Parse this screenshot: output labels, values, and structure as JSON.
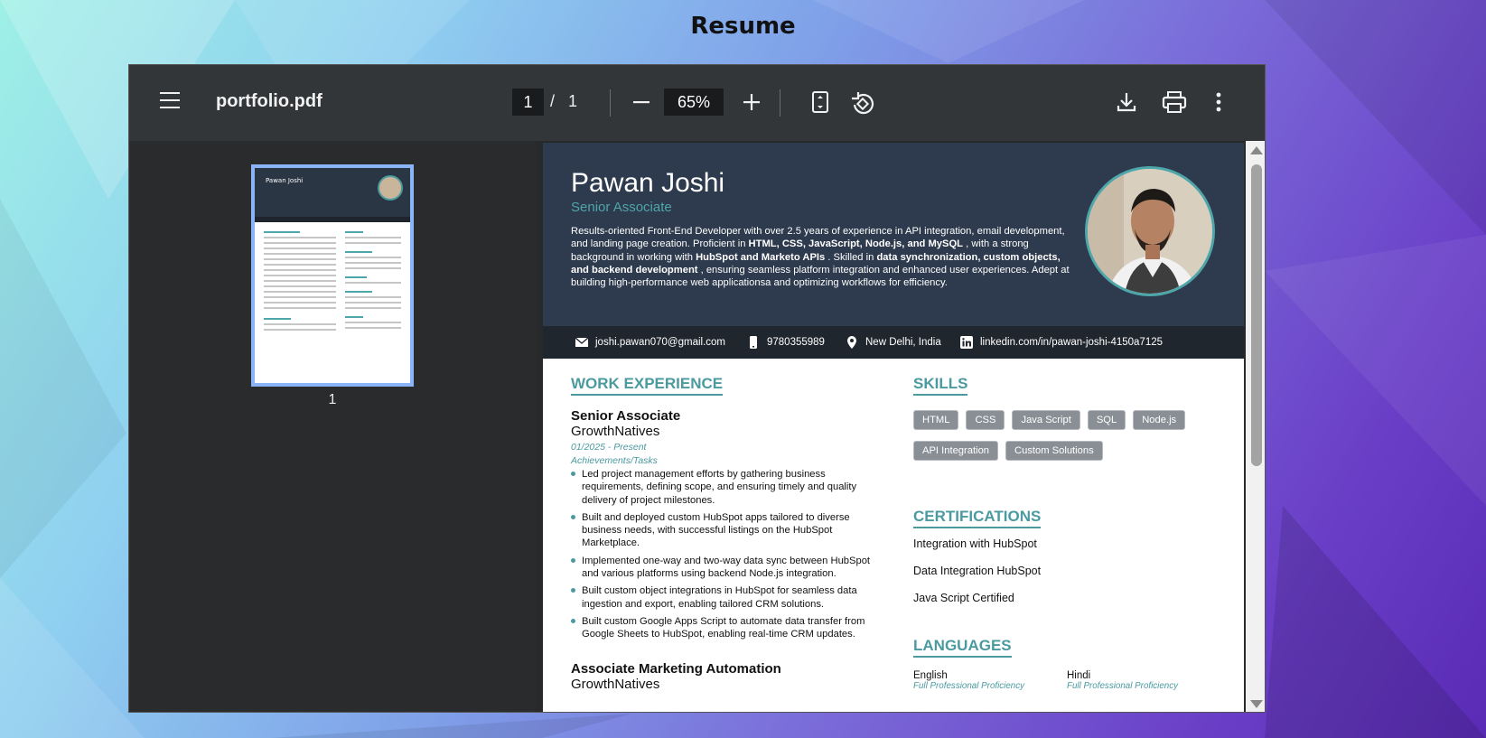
{
  "page": {
    "title": "Resume"
  },
  "viewer": {
    "filename": "portfolio.pdf",
    "current_page": "1",
    "page_separator": "/",
    "total_pages": "1",
    "zoom": "65%",
    "thumbnail_label": "1",
    "thumbnail_name": "Pawan Joshi",
    "colors": {
      "toolbar": "#323639",
      "sidebar": "#2a2b2d",
      "accent": "#8ab4f8"
    }
  },
  "resume": {
    "name": "Pawan Joshi",
    "role": "Senior Associate",
    "summary_parts": [
      "Results-oriented Front-End Developer with over 2.5 years of experience in API integration, email development, and landing page creation. Proficient in ",
      "HTML, CSS, JavaScript, Node.js, and MySQL",
      " , with a strong background in working with ",
      "HubSpot and Marketo APIs",
      " . Skilled in ",
      "data synchronization, custom objects, and backend development",
      " , ensuring seamless platform integration and enhanced user experiences. Adept at building high-performance web applicationsa and optimizing workflows for efficiency."
    ],
    "contact": {
      "email": "joshi.pawan070@gmail.com",
      "phone": "9780355989",
      "location": "New Delhi, India",
      "linkedin": "linkedin.com/in/pawan-joshi-4150a7125"
    },
    "work_experience": {
      "heading": "WORK EXPERIENCE",
      "jobs": [
        {
          "title": "Senior Associate",
          "company": "GrowthNatives",
          "dates": "01/2025 - Present",
          "subhead": "Achievements/Tasks",
          "bullets": [
            "Led project management efforts by gathering business requirements, defining scope, and ensuring timely and quality delivery of project milestones.",
            "Built and deployed custom HubSpot apps tailored to diverse business needs, with successful listings on the HubSpot Marketplace.",
            "Implemented one-way and two-way data sync between HubSpot and various platforms using backend Node.js integration.",
            "Built custom object integrations in HubSpot for seamless data ingestion and export, enabling tailored CRM solutions.",
            "Built custom Google Apps Script to automate data transfer from Google Sheets to HubSpot, enabling real-time CRM updates."
          ]
        },
        {
          "title": "Associate Marketing Automation",
          "company": "GrowthNatives"
        }
      ]
    },
    "skills": {
      "heading": "SKILLS",
      "items": [
        "HTML",
        "CSS",
        "Java Script",
        "SQL",
        "Node.js",
        "API Integration",
        "Custom Solutions"
      ]
    },
    "certifications": {
      "heading": "CERTIFICATIONS",
      "items": [
        "Integration with HubSpot",
        "Data Integration HubSpot",
        "Java Script Certified"
      ]
    },
    "languages": {
      "heading": "LANGUAGES",
      "items": [
        {
          "name": "English",
          "level": "Full Professional Proficiency"
        },
        {
          "name": "Hindi",
          "level": "Full Professional Proficiency"
        }
      ]
    }
  }
}
